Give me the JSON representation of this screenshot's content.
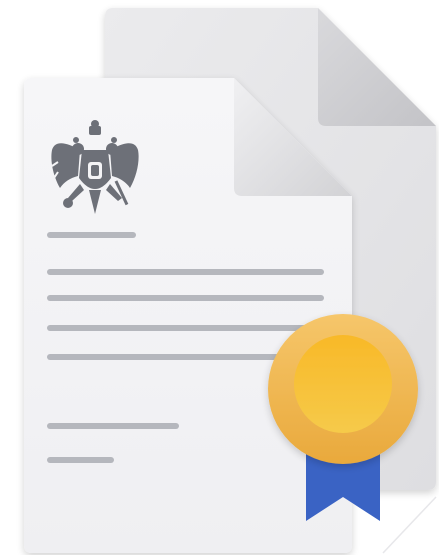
{
  "illustration": {
    "back_document_icon": "document-icon",
    "front_document_icon": "document-icon",
    "emblem_icon": "double-headed-eagle-icon",
    "seal_icon": "award-medal-icon",
    "ribbon_icon": "ribbon-icon",
    "colors": {
      "paper_front": "#f4f4f6",
      "paper_back": "#e4e4e6",
      "page_fold": "#d4d4d6",
      "text_lines": "#b5b7bd",
      "emblem": "#6d7078",
      "medal_outer": "#f2b648",
      "medal_inner": "#f7c534",
      "ribbon": "#3a63c4"
    }
  }
}
